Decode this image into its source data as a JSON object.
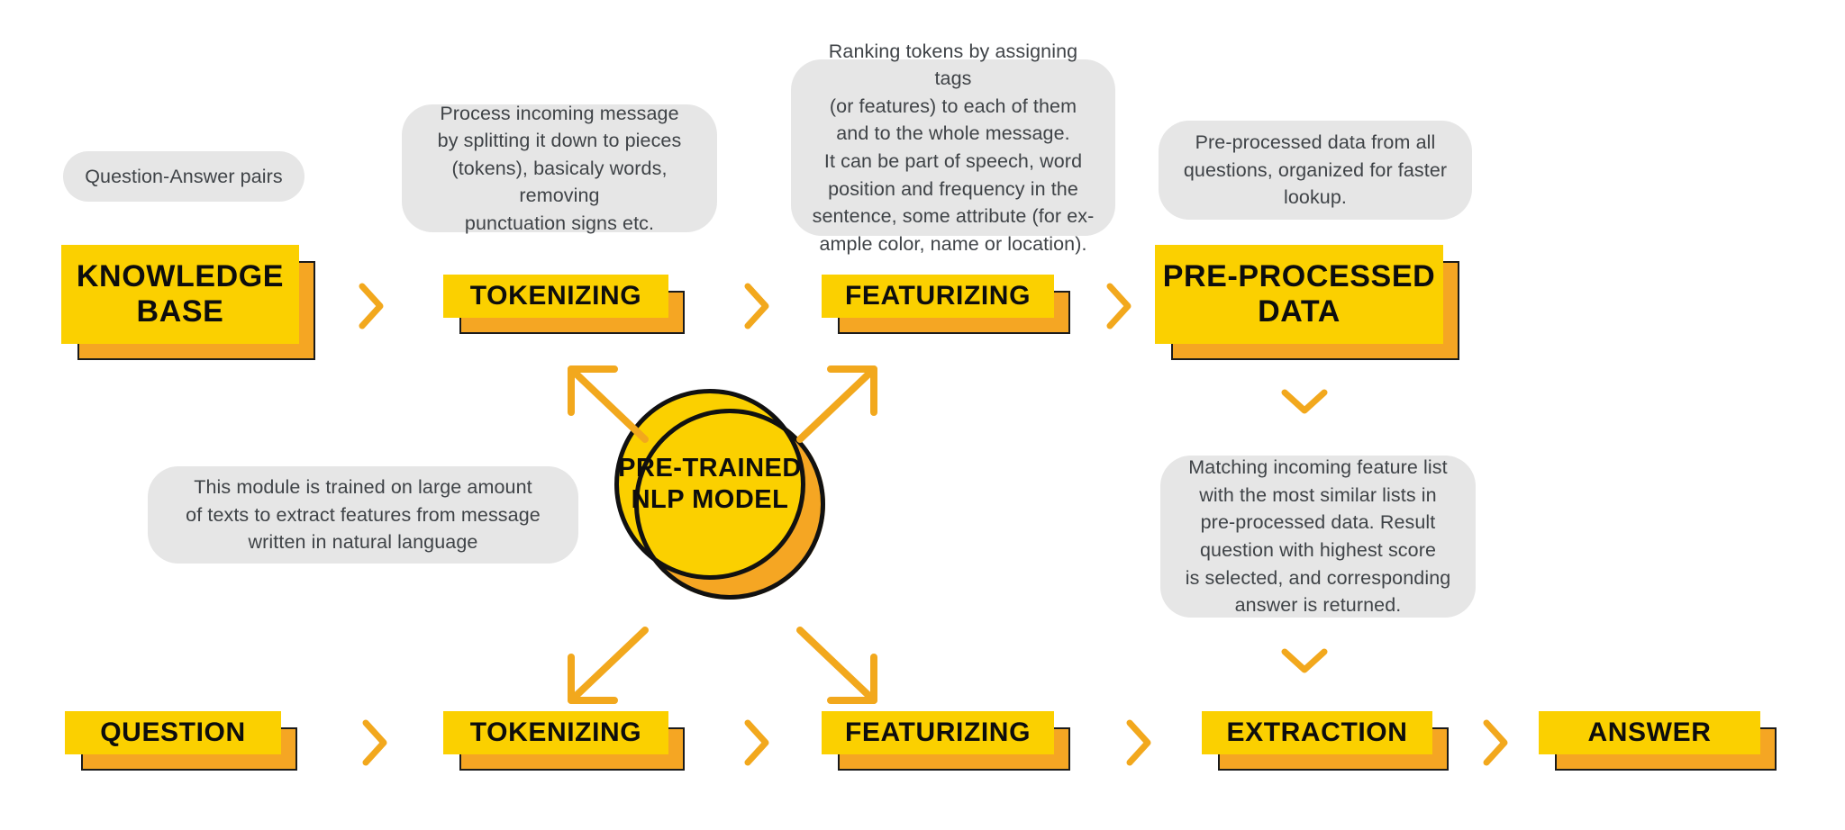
{
  "diagram": {
    "title": "NLP chatbot pipeline",
    "colors": {
      "yellow": "#FBD000",
      "orange": "#F5A623",
      "outline": "#1B1B1B",
      "bubble_bg": "#E6E6E6",
      "bubble_text": "#3F4347"
    }
  },
  "bubbles": [
    {
      "id": "qa-pairs",
      "text": "Question-Answer pairs"
    },
    {
      "id": "tokenizing-top",
      "text": "Process incoming message\nby splitting it down to pieces\n(tokens), basicaly words, removing\npunctuation signs etc."
    },
    {
      "id": "featurizing-top",
      "text": "Ranking tokens by assigning tags\n(or features) to each of them\nand to the whole message.\nIt can be part of speech, word\nposition and frequency in the\nsentence, some attribute (for ex-\nample color, name or location)."
    },
    {
      "id": "preprocessed",
      "text": "Pre-processed data from all\nquestions, organized for faster\nlookup."
    },
    {
      "id": "nlp-model",
      "text": "This module is trained on large amount\nof texts to extract features from message\nwritten in natural language"
    },
    {
      "id": "extraction",
      "text": "Matching incoming feature list\nwith the most similar lists in\npre-processed data. Result\nquestion with highest score\nis selected, and corresponding\nanswer is returned."
    }
  ],
  "nodes": {
    "knowledge_base": "KNOWLEDGE\nBASE",
    "tokenizing_top": "TOKENIZING",
    "featurizing_top": "FEATURIZING",
    "preprocessed": "PRE-PROCESSED\nDATA",
    "question": "QUESTION",
    "tokenizing_bot": "TOKENIZING",
    "featurizing_bot": "FEATURIZING",
    "extraction": "EXTRACTION",
    "answer": "ANSWER"
  },
  "circle": {
    "label": "PRE-TRAINED\nNLP MODEL"
  },
  "connectors": [
    {
      "id": "chev-kb-tok",
      "kind": "chevron-right"
    },
    {
      "id": "chev-tok-feat",
      "kind": "chevron-right"
    },
    {
      "id": "chev-feat-pre",
      "kind": "chevron-right"
    },
    {
      "id": "chev-pre-down",
      "kind": "chevron-down"
    },
    {
      "id": "chev-extract-down",
      "kind": "chevron-down"
    },
    {
      "id": "chev-q-tok",
      "kind": "chevron-right"
    },
    {
      "id": "chev-tok-feat-b",
      "kind": "chevron-right"
    },
    {
      "id": "chev-feat-ext",
      "kind": "chevron-right"
    },
    {
      "id": "chev-ext-ans",
      "kind": "chevron-right"
    },
    {
      "id": "arrow-up-left",
      "kind": "arrow-diagonal-up-left"
    },
    {
      "id": "arrow-up-right",
      "kind": "arrow-diagonal-up-right"
    },
    {
      "id": "arrow-down-left",
      "kind": "arrow-diagonal-down-left"
    },
    {
      "id": "arrow-down-right",
      "kind": "arrow-diagonal-down-right"
    }
  ]
}
